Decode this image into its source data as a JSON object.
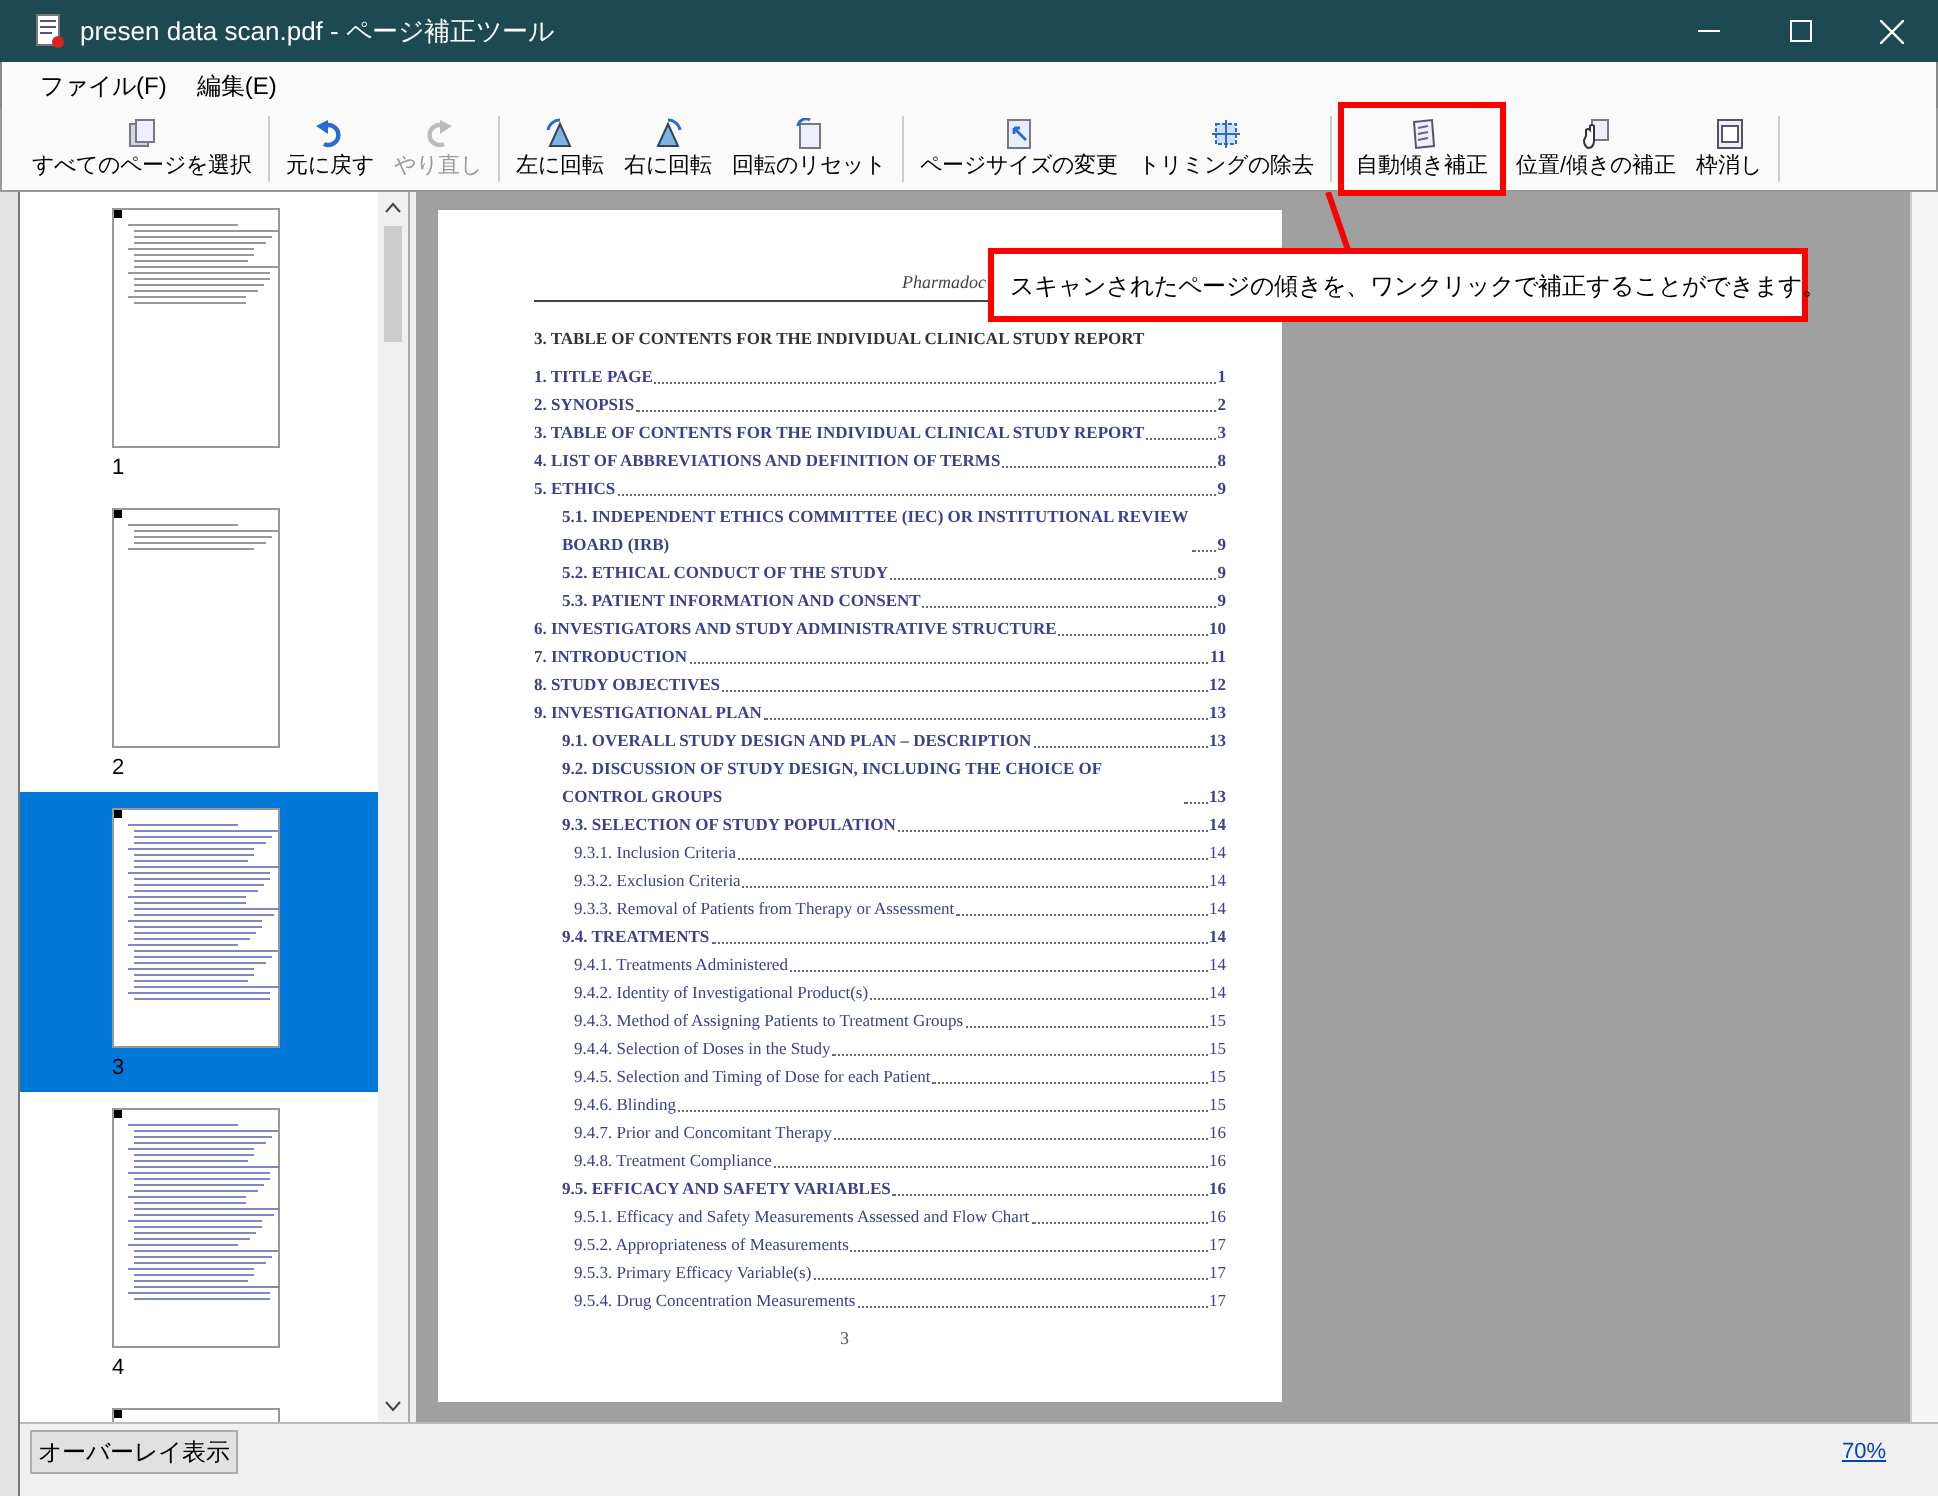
{
  "window": {
    "title": "presen data scan.pdf - ページ補正ツール"
  },
  "menu": [
    "ファイル(F)",
    "編集(E)"
  ],
  "toolbar": [
    {
      "label": "すべてのページを選択",
      "kind": "pages",
      "disabled": false,
      "highlighted": false,
      "separator_after": true
    },
    {
      "label": "元に戻す",
      "kind": "undo",
      "disabled": false,
      "highlighted": false,
      "separator_after": false
    },
    {
      "label": "やり直し",
      "kind": "redo",
      "disabled": true,
      "highlighted": false,
      "separator_after": true
    },
    {
      "label": "左に回転",
      "kind": "rotate-left",
      "disabled": false,
      "highlighted": false,
      "separator_after": false
    },
    {
      "label": "右に回転",
      "kind": "rotate-right",
      "disabled": false,
      "highlighted": false,
      "separator_after": false
    },
    {
      "label": "回転のリセット",
      "kind": "rotate-reset",
      "disabled": false,
      "highlighted": false,
      "separator_after": true
    },
    {
      "label": "ページサイズの変更",
      "kind": "page-size",
      "disabled": false,
      "highlighted": false,
      "separator_after": false
    },
    {
      "label": "トリミングの除去",
      "kind": "trim",
      "disabled": false,
      "highlighted": false,
      "separator_after": true
    },
    {
      "label": "自動傾き補正",
      "kind": "deskew",
      "disabled": false,
      "highlighted": true,
      "separator_after": false
    },
    {
      "label": "位置/傾きの補正",
      "kind": "position",
      "disabled": false,
      "highlighted": false,
      "separator_after": false
    },
    {
      "label": "枠消し",
      "kind": "frame-erase",
      "disabled": false,
      "highlighted": false,
      "separator_after": true
    }
  ],
  "thumbnails": [
    {
      "label": "1",
      "selected": false
    },
    {
      "label": "2",
      "selected": false
    },
    {
      "label": "3",
      "selected": true
    },
    {
      "label": "4",
      "selected": false
    },
    {
      "selected": false
    }
  ],
  "callout": {
    "text": "スキャンされたページの傾きを、ワンクリックで補正することができます。"
  },
  "document": {
    "header": "Pharmadoc",
    "heading": "3.  TABLE OF CONTENTS FOR THE INDIVIDUAL CLINICAL STUDY REPORT",
    "toc": [
      {
        "text": "1. TITLE PAGE",
        "page": "1"
      },
      {
        "text": "2. SYNOPSIS",
        "page": "2"
      },
      {
        "text": "3. TABLE OF CONTENTS FOR THE INDIVIDUAL CLINICAL STUDY REPORT",
        "page": "3"
      },
      {
        "text": "4. LIST OF ABBREVIATIONS AND DEFINITION OF TERMS",
        "page": "8"
      },
      {
        "text": "5. ETHICS",
        "page": "9",
        "children": [
          {
            "text": "5.1. INDEPENDENT ETHICS COMMITTEE (IEC) OR INSTITUTIONAL REVIEW BOARD (IRB)",
            "page": "9"
          },
          {
            "text": "5.2. ETHICAL CONDUCT OF THE STUDY",
            "page": "9"
          },
          {
            "text": "5.3. PATIENT INFORMATION AND CONSENT",
            "page": "9"
          }
        ]
      },
      {
        "text": "6. INVESTIGATORS AND STUDY ADMINISTRATIVE STRUCTURE",
        "page": "10"
      },
      {
        "text": "7. INTRODUCTION",
        "page": "11"
      },
      {
        "text": "8. STUDY OBJECTIVES",
        "page": "12"
      },
      {
        "text": "9. INVESTIGATIONAL PLAN",
        "page": "13",
        "children": [
          {
            "text": "9.1. OVERALL STUDY DESIGN AND PLAN – DESCRIPTION",
            "page": "13"
          },
          {
            "text": "9.2. DISCUSSION OF STUDY DESIGN, INCLUDING THE CHOICE OF CONTROL GROUPS",
            "page": "13"
          },
          {
            "text": "9.3. SELECTION OF STUDY POPULATION",
            "page": "14",
            "children": [
              {
                "text": "9.3.1. Inclusion Criteria",
                "page": "14"
              },
              {
                "text": "9.3.2. Exclusion Criteria",
                "page": "14"
              },
              {
                "text": "9.3.3. Removal of Patients from Therapy or Assessment",
                "page": "14"
              }
            ]
          },
          {
            "text": "9.4. TREATMENTS",
            "page": "14",
            "children": [
              {
                "text": "9.4.1. Treatments Administered",
                "page": "14"
              },
              {
                "text": "9.4.2. Identity of Investigational Product(s)",
                "page": "14"
              },
              {
                "text": "9.4.3. Method of Assigning Patients to Treatment Groups",
                "page": "15"
              },
              {
                "text": "9.4.4. Selection of Doses in the Study",
                "page": "15"
              },
              {
                "text": "9.4.5. Selection and Timing of Dose for each Patient",
                "page": "15"
              },
              {
                "text": "9.4.6. Blinding",
                "page": "15"
              },
              {
                "text": "9.4.7. Prior and Concomitant Therapy",
                "page": "16"
              },
              {
                "text": "9.4.8. Treatment Compliance",
                "page": "16"
              }
            ]
          },
          {
            "text": "9.5. EFFICACY AND SAFETY VARIABLES",
            "page": "16",
            "children": [
              {
                "text": "9.5.1. Efficacy and Safety Measurements Assessed and Flow Chart",
                "page": "16"
              },
              {
                "text": "9.5.2. Appropriateness of Measurements",
                "page": "17"
              },
              {
                "text": "9.5.3. Primary Efficacy Variable(s)",
                "page": "17"
              },
              {
                "text": "9.5.4. Drug Concentration Measurements",
                "page": "17"
              }
            ]
          }
        ]
      }
    ],
    "page_number": "3"
  },
  "status_bar": {
    "overlay_button": "オーバーレイ表示",
    "zoom": "70%"
  }
}
